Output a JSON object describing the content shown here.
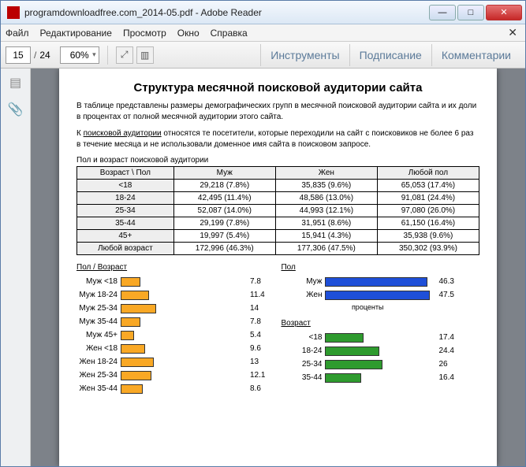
{
  "window": {
    "title": "programdownloadfree.com_2014-05.pdf - Adobe Reader"
  },
  "menus": [
    "Файл",
    "Редактирование",
    "Просмотр",
    "Окно",
    "Справка"
  ],
  "toolbar": {
    "page_current": "15",
    "page_total": "24",
    "zoom": "60%",
    "tools": "Инструменты",
    "sign": "Подписание",
    "comments": "Комментарии"
  },
  "document": {
    "title": "Структура месячной поисковой аудитории сайта",
    "para1": "В таблице представлены размеры демографических групп в месячной поисковой аудитории сайта и их доли в процентах от полной месячной аудитории этого сайта.",
    "para2a": "К ",
    "para2u": "поисковой аудитории",
    "para2b": " относятся те посетители, которые переходили на сайт с поисковиков не более 6 раз в течение месяца и не использовали доменное имя сайта в поисковом запросе.",
    "table_caption": "Пол и возраст поисковой аудитории",
    "cols": [
      "Возраст \\ Пол",
      "Муж",
      "Жен",
      "Любой пол"
    ],
    "rows": [
      [
        "<18",
        "29,218 (7.8%)",
        "35,835 (9.6%)",
        "65,053 (17.4%)"
      ],
      [
        "18-24",
        "42,495 (11.4%)",
        "48,586 (13.0%)",
        "91,081 (24.4%)"
      ],
      [
        "25-34",
        "52,087 (14.0%)",
        "44,993 (12.1%)",
        "97,080 (26.0%)"
      ],
      [
        "35-44",
        "29,199 (7.8%)",
        "31,951 (8.6%)",
        "61,150 (16.4%)"
      ],
      [
        "45+",
        "19,997 (5.4%)",
        "15,941 (4.3%)",
        "35,938 (9.6%)"
      ],
      [
        "Любой возраст",
        "172,996 (46.3%)",
        "177,306 (47.5%)",
        "350,302 (93.9%)"
      ]
    ]
  },
  "chart_data": [
    {
      "type": "bar",
      "title": "Пол / Возраст",
      "orientation": "horizontal",
      "color": "#f9a825",
      "xlabel": "проценты",
      "categories": [
        "Муж <18",
        "Муж 18-24",
        "Муж 25-34",
        "Муж 35-44",
        "Муж 45+",
        "Жен <18",
        "Жен 18-24",
        "Жен 25-34",
        "Жен 35-44"
      ],
      "values": [
        7.8,
        11.4,
        14.0,
        7.8,
        5.4,
        9.6,
        13.0,
        12.1,
        8.6
      ],
      "xlim": [
        0,
        50
      ]
    },
    {
      "type": "bar",
      "title": "Пол",
      "orientation": "horizontal",
      "color": "#1e4fd8",
      "xlabel": "проценты",
      "categories": [
        "Муж",
        "Жен"
      ],
      "values": [
        46.3,
        47.5
      ],
      "xlim": [
        0,
        50
      ]
    },
    {
      "type": "bar",
      "title": "Возраст",
      "orientation": "horizontal",
      "color": "#2e9b2e",
      "xlabel": "проценты",
      "categories": [
        "<18",
        "18-24",
        "25-34",
        "35-44"
      ],
      "values": [
        17.4,
        24.4,
        26.0,
        16.4
      ],
      "xlim": [
        0,
        50
      ]
    }
  ]
}
